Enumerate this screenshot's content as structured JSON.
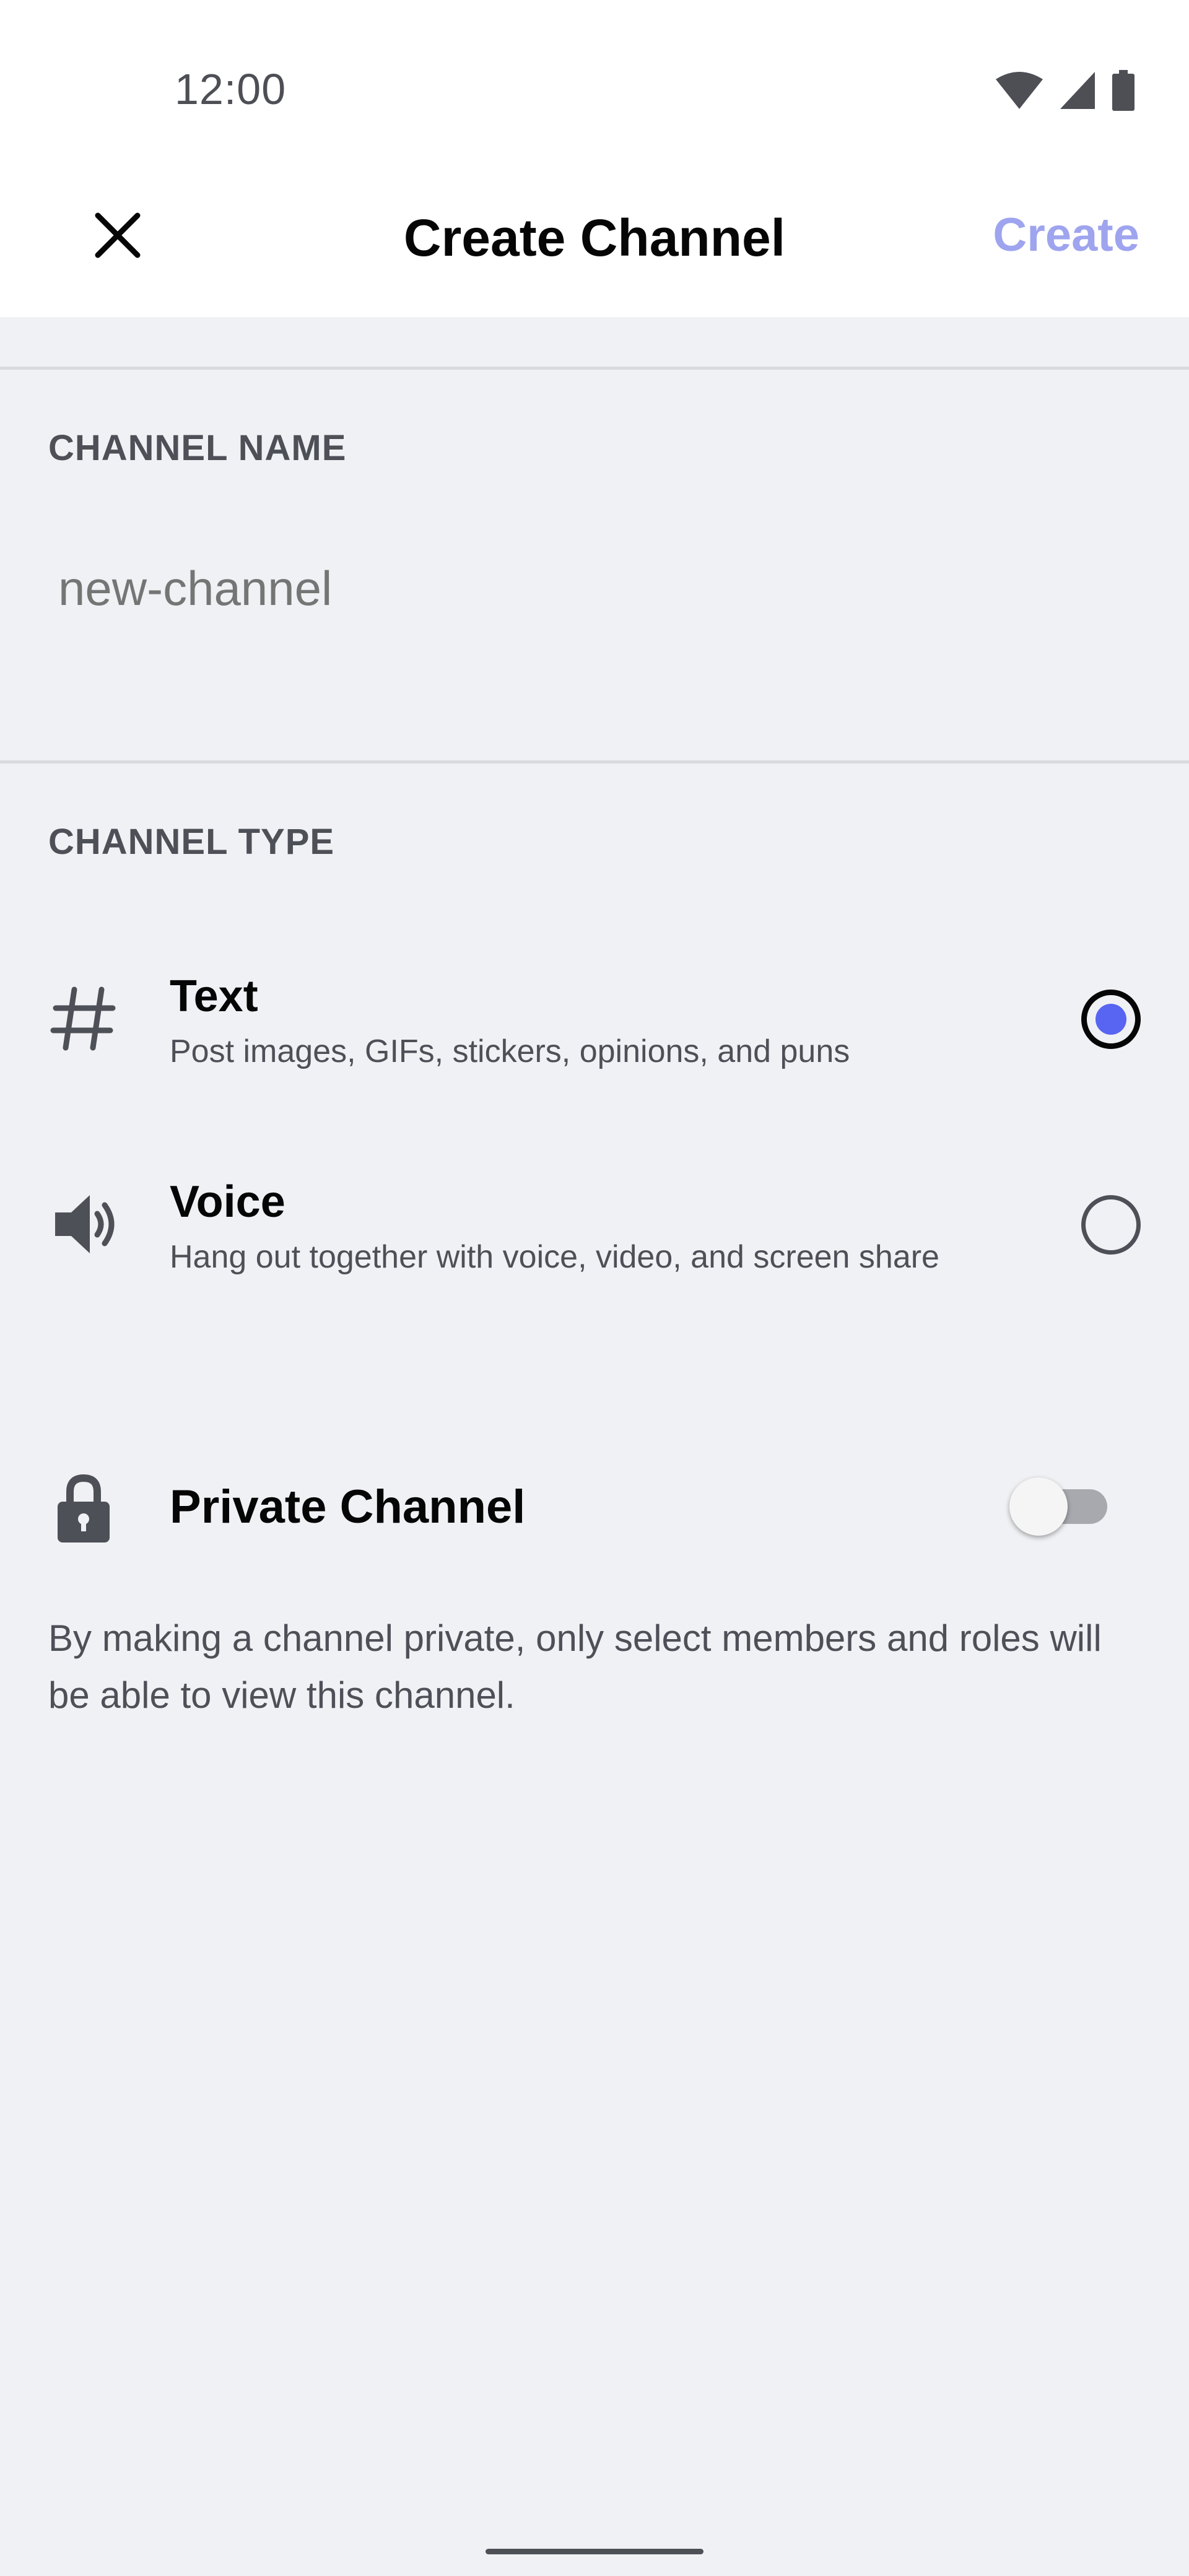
{
  "status_bar": {
    "time": "12:00",
    "icons": [
      "wifi-icon",
      "cell-signal-icon",
      "battery-icon"
    ]
  },
  "header": {
    "close_icon": "close-icon",
    "title": "Create Channel",
    "create_label": "Create"
  },
  "channel_name": {
    "section_label": "CHANNEL NAME",
    "placeholder": "new-channel",
    "value": ""
  },
  "channel_type": {
    "section_label": "CHANNEL TYPE",
    "selected": "text",
    "options": [
      {
        "id": "text",
        "icon": "hash-icon",
        "title": "Text",
        "description": "Post images, GIFs, stickers, opinions, and puns"
      },
      {
        "id": "voice",
        "icon": "speaker-icon",
        "title": "Voice",
        "description": "Hang out together with voice, video, and screen share"
      }
    ]
  },
  "private_channel": {
    "icon": "lock-icon",
    "label": "Private Channel",
    "enabled": false,
    "help_text": "By making a channel private, only select members and roles will be able to view this channel."
  },
  "colors": {
    "accent": "#5865f2",
    "create_disabled": "#9ea4ee",
    "background": "#f0f1f4",
    "surface": "#ffffff"
  }
}
